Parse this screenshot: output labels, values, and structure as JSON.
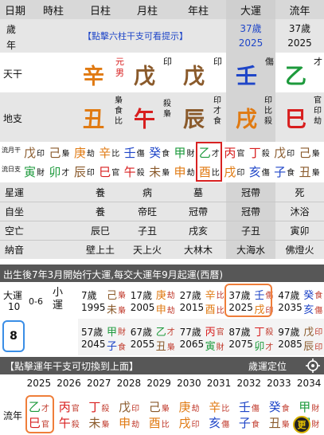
{
  "header": {
    "cols": [
      "日期",
      "時柱",
      "日柱",
      "月柱",
      "年柱",
      "大運",
      "流年"
    ]
  },
  "age_row": {
    "label_top": "歲",
    "label_bottom": "年",
    "hint": "【點擊六柱干支可看提示】",
    "dayun_age": "37歲",
    "dayun_year": "2025",
    "liunian_age": "37歲",
    "liunian_year": "2025"
  },
  "tiangan": {
    "label": "天干",
    "day": {
      "char": "辛",
      "tag1": "元",
      "tag2": "男"
    },
    "month": {
      "char": "戊",
      "tag": "印"
    },
    "year": {
      "char": "戊",
      "tag": "印"
    },
    "dayun": {
      "char": "壬",
      "tag": "傷"
    },
    "liunian": {
      "char": "乙",
      "tag": "才"
    }
  },
  "dizhi": {
    "label": "地支",
    "day": {
      "char": "丑",
      "tags": [
        "梟",
        "食",
        "比"
      ]
    },
    "month": {
      "char": "午",
      "tags": [
        "殺",
        "梟"
      ]
    },
    "year": {
      "char": "辰",
      "tags": [
        "印",
        "才",
        "食"
      ]
    },
    "dayun": {
      "char": "戌",
      "tags": [
        "印",
        "比",
        "殺"
      ]
    },
    "liunian": {
      "char": "巳",
      "tags": [
        "官",
        "印",
        "劫"
      ]
    }
  },
  "liu": {
    "label_top": "流月干",
    "label_bottom": "流日支",
    "pairs_top": [
      [
        "戊",
        "印"
      ],
      [
        "己",
        "梟"
      ],
      [
        "庚",
        "劫"
      ],
      [
        "辛",
        "比"
      ],
      [
        "壬",
        "傷"
      ],
      [
        "癸",
        "食"
      ],
      [
        "甲",
        "財"
      ],
      [
        "乙",
        "才"
      ],
      [
        "丙",
        "官"
      ],
      [
        "丁",
        "殺"
      ],
      [
        "戊",
        "印"
      ],
      [
        "己",
        "梟"
      ]
    ],
    "pairs_bottom": [
      [
        "寅",
        "財"
      ],
      [
        "卯",
        "才"
      ],
      [
        "辰",
        "印"
      ],
      [
        "巳",
        "官"
      ],
      [
        "午",
        "殺"
      ],
      [
        "未",
        "梟"
      ],
      [
        "申",
        "劫"
      ],
      [
        "酉",
        "比"
      ],
      [
        "戌",
        "印"
      ],
      [
        "亥",
        "傷"
      ],
      [
        "子",
        "食"
      ],
      [
        "丑",
        "梟"
      ]
    ]
  },
  "xingyun": {
    "label": "星運",
    "day": "養",
    "month": "病",
    "year": "墓",
    "dayun": "冠帶",
    "liunian": "死"
  },
  "zizuo": {
    "label": "自坐",
    "day": "養",
    "month": "帝旺",
    "year": "冠帶",
    "dayun": "冠帶",
    "liunian": "沐浴"
  },
  "kongwang": {
    "label": "空亡",
    "day": "辰巳",
    "month": "子丑",
    "year": "戌亥",
    "dayun": "子丑",
    "liunian": "寅卯"
  },
  "nayin": {
    "label": "納音",
    "day": "壁上土",
    "month": "天上火",
    "year": "大林木",
    "dayun": "大海水",
    "liunian": "佛燈火"
  },
  "dayun_info": {
    "banner": "出生後7年3月開始行大運,每交大運年9月起運(西曆)",
    "label": "大運",
    "start_age": "10",
    "range": "0-6",
    "xiaoyun": "小運",
    "selected": "8",
    "items_top": [
      {
        "age": "7歲",
        "year": "1995",
        "gan": "己",
        "gt": "梟",
        "zhi": "未",
        "zt": "梟"
      },
      {
        "age": "17歲",
        "year": "2005",
        "gan": "庚",
        "gt": "劫",
        "zhi": "申",
        "zt": "劫"
      },
      {
        "age": "27歲",
        "year": "2015",
        "gan": "辛",
        "gt": "比",
        "zhi": "酉",
        "zt": "比"
      },
      {
        "age": "37歲",
        "year": "2025",
        "gan": "壬",
        "gt": "傷",
        "zhi": "戌",
        "zt": "印"
      },
      {
        "age": "47歲",
        "year": "2035",
        "gan": "癸",
        "gt": "食",
        "zhi": "亥",
        "zt": "傷"
      }
    ],
    "items_bottom": [
      {
        "age": "57歲",
        "year": "2045",
        "gan": "甲",
        "gt": "財",
        "zhi": "子",
        "zt": "食"
      },
      {
        "age": "67歲",
        "year": "2055",
        "gan": "乙",
        "gt": "才",
        "zhi": "丑",
        "zt": "梟"
      },
      {
        "age": "77歲",
        "year": "2065",
        "gan": "丙",
        "gt": "官",
        "zhi": "寅",
        "zt": "財"
      },
      {
        "age": "87歲",
        "year": "2075",
        "gan": "丁",
        "gt": "殺",
        "zhi": "卯",
        "zt": "才"
      },
      {
        "age": "97歲",
        "year": "2085",
        "gan": "戊",
        "gt": "印",
        "zhi": "辰",
        "zt": "印"
      }
    ]
  },
  "liunian_bar": {
    "title": "【點擊運年干支可切換到上面】",
    "locate": "歲運定位"
  },
  "liunian_list": {
    "label": "流年",
    "years": [
      "2025",
      "2026",
      "2027",
      "2028",
      "2029",
      "2030",
      "2031",
      "2032",
      "2033",
      "2034"
    ],
    "items": [
      {
        "gan": "乙",
        "gt": "才",
        "zhi": "巳",
        "zt": "官"
      },
      {
        "gan": "丙",
        "gt": "官",
        "zhi": "午",
        "zt": "殺"
      },
      {
        "gan": "丁",
        "gt": "殺",
        "zhi": "未",
        "zt": "梟"
      },
      {
        "gan": "戊",
        "gt": "印",
        "zhi": "申",
        "zt": "劫"
      },
      {
        "gan": "己",
        "gt": "梟",
        "zhi": "酉",
        "zt": "比"
      },
      {
        "gan": "庚",
        "gt": "劫",
        "zhi": "戌",
        "zt": "印"
      },
      {
        "gan": "辛",
        "gt": "比",
        "zhi": "亥",
        "zt": "傷"
      },
      {
        "gan": "壬",
        "gt": "傷",
        "zhi": "子",
        "zt": "食"
      },
      {
        "gan": "癸",
        "gt": "食",
        "zhi": "丑",
        "zt": "梟"
      },
      {
        "gan": "甲",
        "gt": "財",
        "zhi": "寅",
        "zt": "財"
      }
    ]
  },
  "corner_badge": "更"
}
